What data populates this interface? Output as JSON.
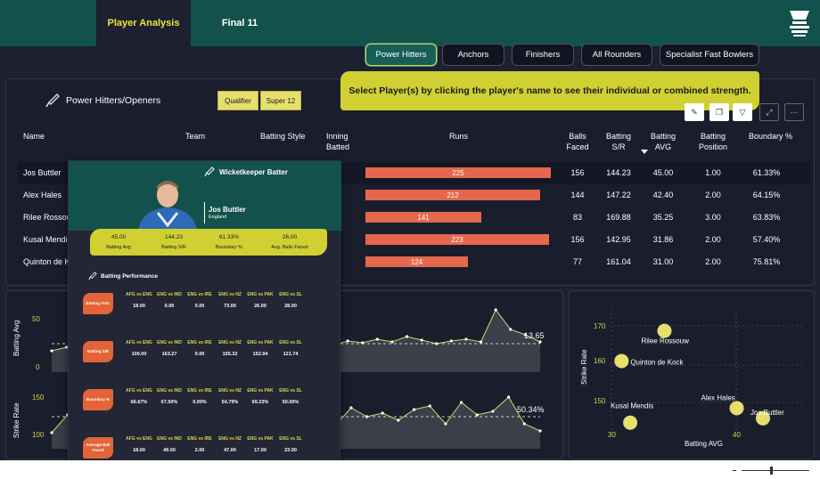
{
  "tabs": {
    "analysis": "Player Analysis",
    "final": "Final 11"
  },
  "categories": [
    "Power Hitters",
    "Anchors",
    "Finishers",
    "All Rounders",
    "Specialist Fast Bowlers"
  ],
  "section": {
    "title": "Power Hitters/Openers",
    "chips": [
      "Qualifier",
      "Super 12"
    ]
  },
  "tooltip": "Select Player(s) by clicking the player's name to see their individual or combined strength.",
  "table": {
    "headers": {
      "name": "Name",
      "team": "Team",
      "style": "Batting Style",
      "inning": "Inning Batted",
      "runs": "Runs",
      "balls": "Balls Faced",
      "sr": "Batting S/R",
      "avg": "Batting AVG",
      "pos": "Batting Position",
      "bnd": "Boundary %"
    },
    "rows": [
      {
        "name": "Jos Buttler",
        "runs": 225,
        "balls": "156",
        "sr": "144.23",
        "avg": "45.00",
        "pos": "1.00",
        "bnd": "61.33%"
      },
      {
        "name": "Alex Hales",
        "runs": 212,
        "balls": "144",
        "sr": "147.22",
        "avg": "42.40",
        "pos": "2.00",
        "bnd": "64.15%"
      },
      {
        "name": "Rilee Rossouw",
        "runs": 141,
        "balls": "83",
        "sr": "169.88",
        "avg": "35.25",
        "pos": "3.00",
        "bnd": "63.83%"
      },
      {
        "name": "Kusal Mendis",
        "runs": 223,
        "balls": "156",
        "sr": "142.95",
        "avg": "31.86",
        "pos": "2.00",
        "bnd": "57.40%"
      },
      {
        "name": "Quinton de Kock",
        "runs": 124,
        "balls": "77",
        "sr": "161.04",
        "avg": "31.00",
        "pos": "2.00",
        "bnd": "75.81%"
      }
    ]
  },
  "card": {
    "role": "Wicketkeeper Batter",
    "name": "Jos Buttler",
    "team": "England",
    "stats": [
      {
        "v": "45.00",
        "l": "Batting Avg"
      },
      {
        "v": "144.23",
        "l": "Batting S/R"
      },
      {
        "v": "61.33%",
        "l": "Boundary %"
      },
      {
        "v": "26.00",
        "l": "Avg. Balls Faced"
      }
    ],
    "perf_title": "Batting Performance",
    "matches": [
      "AFG vs ENG",
      "ENG vs IND",
      "ENG vs IRE",
      "ENG vs NZ",
      "ENG vs PAK",
      "ENG vs SL"
    ],
    "metrics": [
      {
        "label": "Batting AVG.",
        "values": [
          "18.00",
          "0.00",
          "0.00",
          "73.00",
          "26.00",
          "28.00"
        ]
      },
      {
        "label": "Batting S/R",
        "values": [
          "100.00",
          "163.27",
          "0.00",
          "155.32",
          "152.94",
          "121.74"
        ]
      },
      {
        "label": "Boundary %",
        "values": [
          "66.67%",
          "67.50%",
          "0.00%",
          "54.79%",
          "69.23%",
          "50.00%"
        ]
      },
      {
        "label": "Average Ball Faced",
        "values": [
          "18.00",
          "49.00",
          "2.00",
          "47.00",
          "17.00",
          "23.00"
        ]
      }
    ]
  },
  "line_charts": {
    "avg": {
      "ylabel": "Batting Avg",
      "ticks": [
        "50",
        "0"
      ],
      "ref_label": "13.65"
    },
    "sr": {
      "ylabel": "Strike Rate",
      "ticks": [
        "150",
        "100"
      ],
      "ref_label": "50.34%"
    }
  },
  "chart_data": {
    "type": "scatter",
    "xlabel": "Batting AVG",
    "ylabel": "Strike Rate",
    "xlim": [
      30,
      45
    ],
    "ylim": [
      140,
      175
    ],
    "x_ticks": [
      "30",
      "40"
    ],
    "y_ticks": [
      "170",
      "160",
      "150"
    ],
    "points": [
      {
        "name": "Rilee Rossouw",
        "x": 35.25,
        "y": 169.88
      },
      {
        "name": "Quinton de Kock",
        "x": 31.0,
        "y": 161.04
      },
      {
        "name": "Alex Hales",
        "x": 42.4,
        "y": 147.22
      },
      {
        "name": "Kusal Mendis",
        "x": 31.86,
        "y": 142.95
      },
      {
        "name": "Jos Buttler",
        "x": 45.0,
        "y": 144.23
      }
    ]
  },
  "colors": {
    "accent": "#f1e43a",
    "teal": "#13524c",
    "bar": "#e5684e",
    "tooltip": "#d0d033",
    "point": "#e6df6e"
  }
}
